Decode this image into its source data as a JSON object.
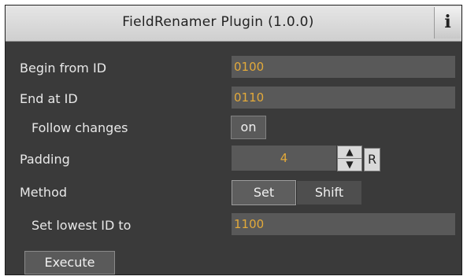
{
  "window": {
    "title": "FieldRenamer Plugin (1.0.0)",
    "info_icon": "i"
  },
  "form": {
    "begin_label": "Begin from ID",
    "begin_value": "0100",
    "end_label": "End at ID",
    "end_value": "0110",
    "follow_label": "Follow changes",
    "follow_value": "on",
    "padding_label": "Padding",
    "padding_value": "4",
    "spinner_up": "▲",
    "spinner_down": "▼",
    "reset_label": "R",
    "method_label": "Method",
    "method_options": [
      "Set",
      "Shift"
    ],
    "method_selected": "Set",
    "lowest_label": "Set lowest ID to",
    "lowest_value": "1100",
    "execute_label": "Execute"
  },
  "colors": {
    "panel_bg": "#3a3a3a",
    "field_bg": "#595959",
    "value_text": "#e2a93a",
    "label_text": "#e8e8e8",
    "titlebar_bg": "#d8d8d8"
  }
}
